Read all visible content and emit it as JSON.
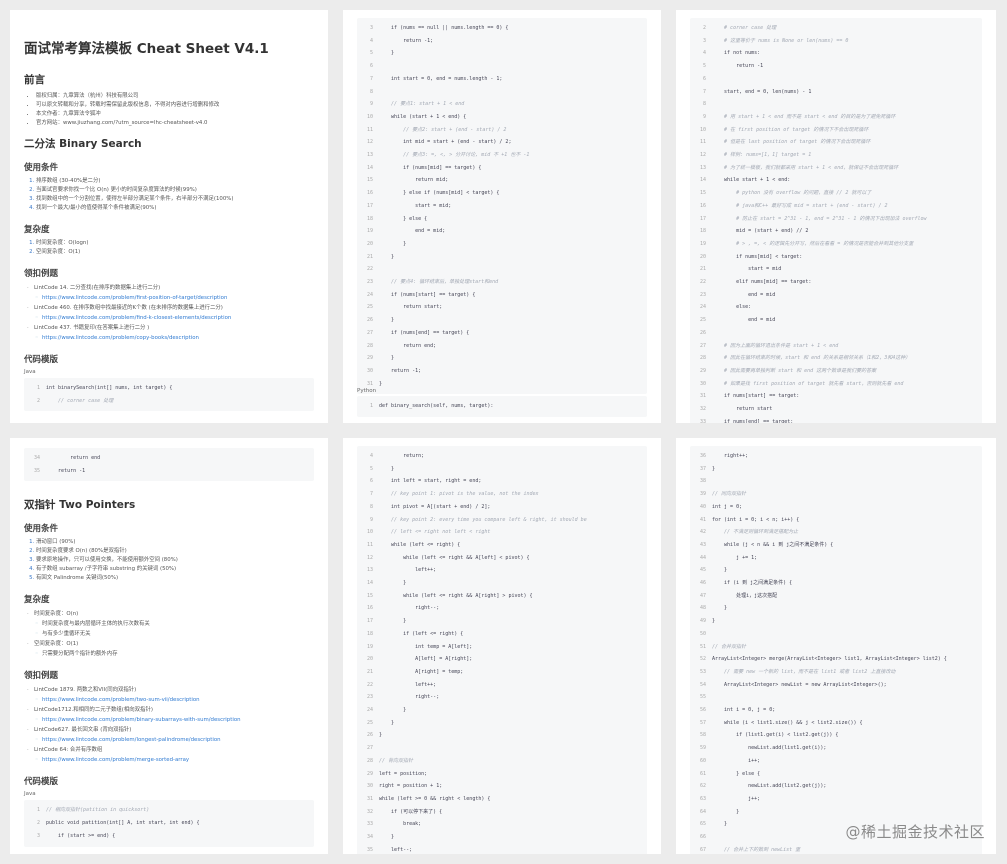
{
  "page1": {
    "title": "面试常考算法模板 Cheat Sheet V4.1",
    "preface_heading": "前言",
    "preface_lines": [
      "版权归属：九章算法（杭州）科技有限公司",
      "可以原文转载和分享，转载时需保留此版权信息，不得对内容进行增删和修改",
      "本文作者：九章算法令狐冲",
      "官方网站：www.jiuzhang.com/?utm_source=lhc-cheatsheet-v4.0"
    ],
    "section_heading": "二分法 Binary Search",
    "usage_heading": "使用条件",
    "usage_items": [
      "排序数组 (30-40%是二分)",
      "当面试官要求你找一个比 O(n) 更小的时间复杂度算法的时候(99%)",
      "找到数组中的一个分割位置，使得左半部分满足某个条件，右半部分不满足(100%)",
      "找到一个最大/最小的值使得某个条件被满足(90%)"
    ],
    "complexity_heading": "复杂度",
    "complexity_items": [
      "时间复杂度：O(logn)",
      "空间复杂度：O(1)"
    ],
    "examples_heading": "领扣例题",
    "examples": [
      {
        "text": "LintCode 14. 二分查找(在排序的数据集上进行二分)",
        "link": "https://www.lintcode.com/problem/first-position-of-target/description"
      },
      {
        "text": "LintCode 460. 在排序数组中找最接近的K个数 (在未排序的数据集上进行二分)",
        "link": "https://www.lintcode.com/problem/find-k-closest-elements/description"
      },
      {
        "text": "LintCode 437. 书籍复印(在答案集上进行二分 )",
        "link": "https://www.lintcode.com/problem/copy-books/description"
      }
    ],
    "code_heading": "代码模版",
    "lang": "Java",
    "code": [
      {
        "n": "1",
        "t": "int binarySearch(int[] nums, int target) {"
      },
      {
        "n": "2",
        "t": "    // corner case 处理"
      }
    ]
  },
  "page2": {
    "code": [
      {
        "n": "3",
        "t": "    if (nums == null || nums.length == 0) {"
      },
      {
        "n": "4",
        "t": "        return -1;"
      },
      {
        "n": "5",
        "t": "    }"
      },
      {
        "n": "6",
        "t": ""
      },
      {
        "n": "7",
        "t": "    int start = 0, end = nums.length - 1;"
      },
      {
        "n": "8",
        "t": ""
      },
      {
        "n": "9",
        "t": "    // 要点1: start + 1 < end"
      },
      {
        "n": "10",
        "t": "    while (start + 1 < end) {"
      },
      {
        "n": "11",
        "t": "        // 要点2: start + (end - start) / 2"
      },
      {
        "n": "12",
        "t": "        int mid = start + (end - start) / 2;"
      },
      {
        "n": "13",
        "t": "        // 要点3: =, <, > 分开讨论, mid 不 +1 也不 -1"
      },
      {
        "n": "14",
        "t": "        if (nums[mid] == target) {"
      },
      {
        "n": "15",
        "t": "            return mid;"
      },
      {
        "n": "16",
        "t": "        } else if (nums[mid] < target) {"
      },
      {
        "n": "17",
        "t": "            start = mid;"
      },
      {
        "n": "18",
        "t": "        } else {"
      },
      {
        "n": "19",
        "t": "            end = mid;"
      },
      {
        "n": "20",
        "t": "        }"
      },
      {
        "n": "21",
        "t": "    }"
      },
      {
        "n": "22",
        "t": ""
      },
      {
        "n": "23",
        "t": "    // 要点4: 循环结束后，单独处理start和end"
      },
      {
        "n": "24",
        "t": "    if (nums[start] == target) {"
      },
      {
        "n": "25",
        "t": "        return start;"
      },
      {
        "n": "26",
        "t": "    }"
      },
      {
        "n": "27",
        "t": "    if (nums[end] == target) {"
      },
      {
        "n": "28",
        "t": "        return end;"
      },
      {
        "n": "29",
        "t": "    }"
      },
      {
        "n": "30",
        "t": "    return -1;"
      },
      {
        "n": "31",
        "t": "}"
      }
    ],
    "lang": "Python",
    "code2": [
      {
        "n": "1",
        "t": "def binary_search(self, nums, target):"
      }
    ]
  },
  "page3": {
    "code": [
      {
        "n": "2",
        "t": "    # corner case 处理"
      },
      {
        "n": "3",
        "t": "    # 这里等价于 nums is None or len(nums) == 0"
      },
      {
        "n": "4",
        "t": "    if not nums:"
      },
      {
        "n": "5",
        "t": "        return -1"
      },
      {
        "n": "6",
        "t": ""
      },
      {
        "n": "7",
        "t": "    start, end = 0, len(nums) - 1"
      },
      {
        "n": "8",
        "t": ""
      },
      {
        "n": "9",
        "t": "    # 用 start + 1 < end 而不是 start < end 的目的是为了避免死循环"
      },
      {
        "n": "10",
        "t": "    # 在 first position of target 的情况下不会出现死循环"
      },
      {
        "n": "11",
        "t": "    # 但是在 last position of target 的情况下会出现死循环"
      },
      {
        "n": "12",
        "t": "    # 样例: nums=[1，1] target = 1"
      },
      {
        "n": "13",
        "t": "    # 为了统一模板，我们就都采用 start + 1 < end，就保证不会出现死循环"
      },
      {
        "n": "14",
        "t": "    while start + 1 < end:"
      },
      {
        "n": "15",
        "t": "        # python 没有 overflow 的问题，直接 // 2 就可以了"
      },
      {
        "n": "16",
        "t": "        # java和C++ 最好写成 mid = start + (end - start) / 2"
      },
      {
        "n": "17",
        "t": "        # 防止在 start = 2^31 - 1, end = 2^31 - 1 的情况下出现加法 overflow"
      },
      {
        "n": "18",
        "t": "        mid = (start + end) // 2"
      },
      {
        "n": "19",
        "t": "        # > , =, < 的逻辑先分开写，然后在看看 = 的情况是否能合并到其他分支里"
      },
      {
        "n": "20",
        "t": "        if nums[mid] < target:"
      },
      {
        "n": "21",
        "t": "            start = mid"
      },
      {
        "n": "22",
        "t": "        elif nums[mid] == target:"
      },
      {
        "n": "23",
        "t": "            end = mid"
      },
      {
        "n": "24",
        "t": "        else:"
      },
      {
        "n": "25",
        "t": "            end = mid"
      },
      {
        "n": "26",
        "t": ""
      },
      {
        "n": "27",
        "t": "    # 因为上面的循环退出条件是 start + 1 < end"
      },
      {
        "n": "28",
        "t": "    # 因此在循环结束的时候，start 和 end 的关系是相邻关系（1和2，3和4这种）"
      },
      {
        "n": "29",
        "t": "    # 因此需要再单独判断 start 和 end 这两个数谁是我们要的答案"
      },
      {
        "n": "30",
        "t": "    # 如果是找 first position of target 就先看 start，否则就先看 end"
      },
      {
        "n": "31",
        "t": "    if nums[start] == target:"
      },
      {
        "n": "32",
        "t": "        return start"
      },
      {
        "n": "33",
        "t": "    if nums[end] == target:"
      }
    ]
  },
  "page4": {
    "code": [
      {
        "n": "34",
        "t": "        return end"
      },
      {
        "n": "35",
        "t": "    return -1"
      }
    ],
    "section_heading": "双指针 Two Pointers",
    "usage_heading": "使用条件",
    "usage_items": [
      "滑动窗口 (90%)",
      "时间复杂度要求 O(n) (80%是双指针)",
      "要求原地操作，只可以使用交换，不能使用额外空间 (80%)",
      "有子数组 subarray /子字符串 substring 的关键词 (50%)",
      "有回文 Palindrome 关键词(50%)"
    ],
    "complexity_heading": "复杂度",
    "complexity": [
      {
        "text": "时间复杂度：O(n)",
        "subs": [
          "时间复杂度与最内层循环主体的执行次数有关",
          "与有多少重循环无关"
        ]
      },
      {
        "text": "空间复杂度：O(1)",
        "subs": [
          "只需要分配两个指针的额外内存"
        ]
      }
    ],
    "examples_heading": "领扣例题",
    "examples": [
      {
        "text": "LintCode 1879. 两数之和VII(同向双指针)",
        "link": "https://www.lintcode.com/problem/two-sum-vii/description"
      },
      {
        "text": "LintCode1712.和相同的二元子数组(相向双指针)",
        "link": "https://www.lintcode.com/problem/binary-subarrays-with-sum/description"
      },
      {
        "text": "LintCode627. 最长回文串 (背向双指针)",
        "link": "https://www.lintcode.com/problem/longest-palindrome/description"
      },
      {
        "text": "LintCode 64: 合并有序数组",
        "link": "https://www.lintcode.com/problem/merge-sorted-array"
      }
    ],
    "code_heading": "代码模版",
    "lang": "Java",
    "code2": [
      {
        "n": "1",
        "t": "// 相向双指针(patition in quicksort)"
      },
      {
        "n": "2",
        "t": "public void patition(int[] A, int start, int end) {"
      },
      {
        "n": "3",
        "t": "    if (start >= end) {"
      }
    ]
  },
  "page5": {
    "code": [
      {
        "n": "4",
        "t": "        return;"
      },
      {
        "n": "5",
        "t": "    }"
      },
      {
        "n": "6",
        "t": "    int left = start, right = end;"
      },
      {
        "n": "7",
        "t": "    // key point 1: pivot is the value, not the index"
      },
      {
        "n": "8",
        "t": "    int pivot = A[(start + end) / 2];"
      },
      {
        "n": "9",
        "t": "    // key point 2: every time you compare left & right, it should be"
      },
      {
        "n": "10",
        "t": "    // left <= right not left < right"
      },
      {
        "n": "11",
        "t": "    while (left <= right) {"
      },
      {
        "n": "12",
        "t": "        while (left <= right && A[left] < pivot) {"
      },
      {
        "n": "13",
        "t": "            left++;"
      },
      {
        "n": "14",
        "t": "        }"
      },
      {
        "n": "15",
        "t": "        while (left <= right && A[right] > pivot) {"
      },
      {
        "n": "16",
        "t": "            right--;"
      },
      {
        "n": "17",
        "t": "        }"
      },
      {
        "n": "18",
        "t": "        if (left <= right) {"
      },
      {
        "n": "19",
        "t": "            int temp = A[left];"
      },
      {
        "n": "20",
        "t": "            A[left] = A[right];"
      },
      {
        "n": "21",
        "t": "            A[right] = temp;"
      },
      {
        "n": "22",
        "t": "            left++;"
      },
      {
        "n": "23",
        "t": "            right--;"
      },
      {
        "n": "24",
        "t": "        }"
      },
      {
        "n": "25",
        "t": "    }"
      },
      {
        "n": "26",
        "t": "}"
      },
      {
        "n": "27",
        "t": ""
      },
      {
        "n": "28",
        "t": "// 背向双指针"
      },
      {
        "n": "29",
        "t": "left = position;"
      },
      {
        "n": "30",
        "t": "right = position + 1;"
      },
      {
        "n": "31",
        "t": "while (left >= 0 && right < length) {"
      },
      {
        "n": "32",
        "t": "    if (可以停下来了) {"
      },
      {
        "n": "33",
        "t": "        break;"
      },
      {
        "n": "34",
        "t": "    }"
      },
      {
        "n": "35",
        "t": "    left--;"
      }
    ]
  },
  "page6": {
    "code": [
      {
        "n": "36",
        "t": "    right++;"
      },
      {
        "n": "37",
        "t": "}"
      },
      {
        "n": "38",
        "t": ""
      },
      {
        "n": "39",
        "t": "// 同向双指针"
      },
      {
        "n": "40",
        "t": "int j = 0;"
      },
      {
        "n": "41",
        "t": "for (int i = 0; i < n; i++) {"
      },
      {
        "n": "42",
        "t": "    // 不满足则循环到满足搭配为止"
      },
      {
        "n": "43",
        "t": "    while (j < n && i 到 j之间不满足条件) {"
      },
      {
        "n": "44",
        "t": "        j += 1;"
      },
      {
        "n": "45",
        "t": "    }"
      },
      {
        "n": "46",
        "t": "    if (i 到 j之间满足条件) {"
      },
      {
        "n": "47",
        "t": "        处理i，j这次搭配"
      },
      {
        "n": "48",
        "t": "    }"
      },
      {
        "n": "49",
        "t": "}"
      },
      {
        "n": "50",
        "t": ""
      },
      {
        "n": "51",
        "t": "// 合并双指针"
      },
      {
        "n": "52",
        "t": "ArrayList<Integer> merge(ArrayList<Integer> list1, ArrayList<Integer> list2) {"
      },
      {
        "n": "53",
        "t": "    // 需要 new 一个新的 list，而不是在 list1 或者 list2 上直接改动"
      },
      {
        "n": "54",
        "t": "    ArrayList<Integer> newList = new ArrayList<Integer>();"
      },
      {
        "n": "55",
        "t": ""
      },
      {
        "n": "56",
        "t": "    int i = 0, j = 0;"
      },
      {
        "n": "57",
        "t": "    while (i < list1.size() && j < list2.size()) {"
      },
      {
        "n": "58",
        "t": "        if (list1.get(i) < list2.get(j)) {"
      },
      {
        "n": "59",
        "t": "            newList.add(list1.get(i));"
      },
      {
        "n": "60",
        "t": "            i++;"
      },
      {
        "n": "61",
        "t": "        } else {"
      },
      {
        "n": "62",
        "t": "            newList.add(list2.get(j));"
      },
      {
        "n": "63",
        "t": "            j++;"
      },
      {
        "n": "64",
        "t": "        }"
      },
      {
        "n": "65",
        "t": "    }"
      },
      {
        "n": "66",
        "t": ""
      },
      {
        "n": "67",
        "t": "    // 合并上下的数到 newList 里"
      }
    ]
  },
  "watermark": "@稀土掘金技术社区"
}
